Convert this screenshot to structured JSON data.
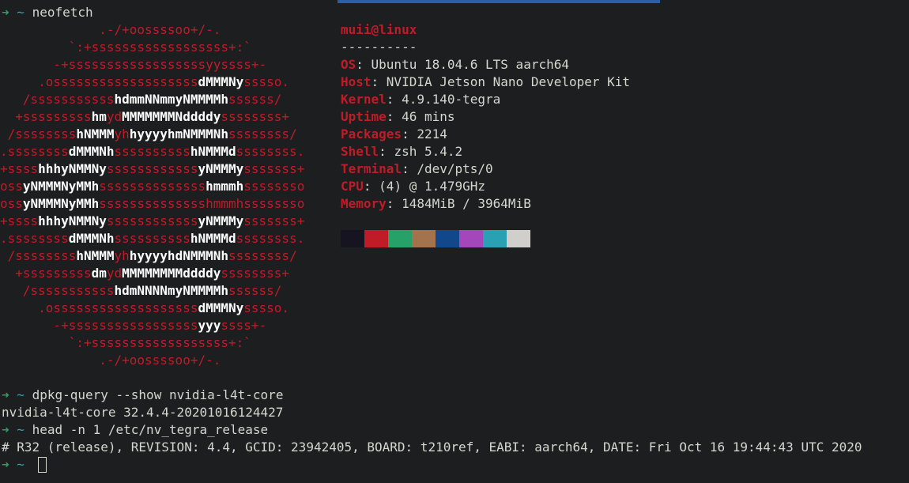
{
  "terminal": {
    "prompt_arrow": "➜",
    "prompt_dir": "~",
    "commands": [
      "neofetch",
      "dpkg-query --show nvidia-l4t-core",
      "head -n 1 /etc/nv_tegra_release"
    ],
    "outputs": [
      "nvidia-l4t-core 32.4.4-20201016124427",
      "# R32 (release), REVISION: 4.4, GCID: 23942405, BOARD: t210ref, EABI: aarch64, DATE: Fri Oct 16 19:44:43 UTC 2020"
    ]
  },
  "neofetch": {
    "logo_lines": [
      [
        [
          "r",
          "             .-/+oossssoo+/-."
        ]
      ],
      [
        [
          "r",
          "         `:+ssssssssssssssssss+:`"
        ]
      ],
      [
        [
          "r",
          "       -+ssssssssssssssssssyyssss+-"
        ]
      ],
      [
        [
          "r",
          "     .osssssssssssssssssss"
        ],
        [
          "w",
          "dMMMNy"
        ],
        [
          "r",
          "sssso."
        ]
      ],
      [
        [
          "r",
          "   /sssssssssss"
        ],
        [
          "w",
          "hdmmNNmmyNMMMMh"
        ],
        [
          "r",
          "ssssss/"
        ]
      ],
      [
        [
          "r",
          "  +sssssssss"
        ],
        [
          "w",
          "hm"
        ],
        [
          "r",
          "yd"
        ],
        [
          "w",
          "MMMMMMMNddddy"
        ],
        [
          "r",
          "ssssssss+"
        ]
      ],
      [
        [
          "r",
          " /ssssssss"
        ],
        [
          "w",
          "hNMMM"
        ],
        [
          "r",
          "yh"
        ],
        [
          "w",
          "hyyyyhmNMMMNh"
        ],
        [
          "r",
          "ssssssss/"
        ]
      ],
      [
        [
          "r",
          ".ssssssss"
        ],
        [
          "w",
          "dMMMNh"
        ],
        [
          "r",
          "ssssssssss"
        ],
        [
          "w",
          "hNMMMd"
        ],
        [
          "r",
          "ssssssss."
        ]
      ],
      [
        [
          "r",
          "+ssss"
        ],
        [
          "w",
          "hhhyNMMNy"
        ],
        [
          "r",
          "ssssssssssss"
        ],
        [
          "w",
          "yNMMMy"
        ],
        [
          "r",
          "sssssss+"
        ]
      ],
      [
        [
          "r",
          "oss"
        ],
        [
          "w",
          "yNMMMNyMMh"
        ],
        [
          "r",
          "ssssssssssssss"
        ],
        [
          "w",
          "hmmmh"
        ],
        [
          "r",
          "ssssssso"
        ]
      ],
      [
        [
          "r",
          "oss"
        ],
        [
          "w",
          "yNMMMNyMMh"
        ],
        [
          "r",
          "sssssssssssssshmmmhssssssso"
        ]
      ],
      [
        [
          "r",
          "+ssss"
        ],
        [
          "w",
          "hhhyNMMNy"
        ],
        [
          "r",
          "ssssssssssss"
        ],
        [
          "w",
          "yNMMMy"
        ],
        [
          "r",
          "sssssss+"
        ]
      ],
      [
        [
          "r",
          ".ssssssss"
        ],
        [
          "w",
          "dMMMNh"
        ],
        [
          "r",
          "ssssssssss"
        ],
        [
          "w",
          "hNMMMd"
        ],
        [
          "r",
          "ssssssss."
        ]
      ],
      [
        [
          "r",
          " /ssssssss"
        ],
        [
          "w",
          "hNMMM"
        ],
        [
          "r",
          "yh"
        ],
        [
          "w",
          "hyyyyhdNMMMNh"
        ],
        [
          "r",
          "ssssssss/"
        ]
      ],
      [
        [
          "r",
          "  +sssssssss"
        ],
        [
          "w",
          "dm"
        ],
        [
          "r",
          "yd"
        ],
        [
          "w",
          "MMMMMMMMddddy"
        ],
        [
          "r",
          "ssssssss+"
        ]
      ],
      [
        [
          "r",
          "   /sssssssssss"
        ],
        [
          "w",
          "hdmNNNNmyNMMMMh"
        ],
        [
          "r",
          "ssssss/"
        ]
      ],
      [
        [
          "r",
          "     .osssssssssssssssssss"
        ],
        [
          "w",
          "dMMMNy"
        ],
        [
          "r",
          "sssso."
        ]
      ],
      [
        [
          "r",
          "       -+sssssssssssssssss"
        ],
        [
          "w",
          "yyy"
        ],
        [
          "r",
          "ssss+-"
        ]
      ],
      [
        [
          "r",
          "         `:+ssssssssssssssssss+:`"
        ]
      ],
      [
        [
          "r",
          "             .-/+oossssoo+/-."
        ]
      ]
    ],
    "user_host": "muii@linux",
    "separator": "----------",
    "info": [
      {
        "key": "OS",
        "value": "Ubuntu 18.04.6 LTS aarch64"
      },
      {
        "key": "Host",
        "value": "NVIDIA Jetson Nano Developer Kit"
      },
      {
        "key": "Kernel",
        "value": "4.9.140-tegra"
      },
      {
        "key": "Uptime",
        "value": "46 mins"
      },
      {
        "key": "Packages",
        "value": "2214"
      },
      {
        "key": "Shell",
        "value": "zsh 5.4.2"
      },
      {
        "key": "Terminal",
        "value": "/dev/pts/0"
      },
      {
        "key": "CPU",
        "value": "(4) @ 1.479GHz"
      },
      {
        "key": "Memory",
        "value": "1484MiB / 3964MiB"
      }
    ],
    "palette": [
      "#171421",
      "#c01c28",
      "#26a269",
      "#a2734c",
      "#12488b",
      "#a347ba",
      "#2aa1b3",
      "#d0cfcc"
    ]
  },
  "colors": {
    "background": "#1c1e1f",
    "logo_red": "#c01c28",
    "logo_white": "#ffffff",
    "prompt_arrow": "#26a269",
    "prompt_dir": "#33a3b3"
  }
}
